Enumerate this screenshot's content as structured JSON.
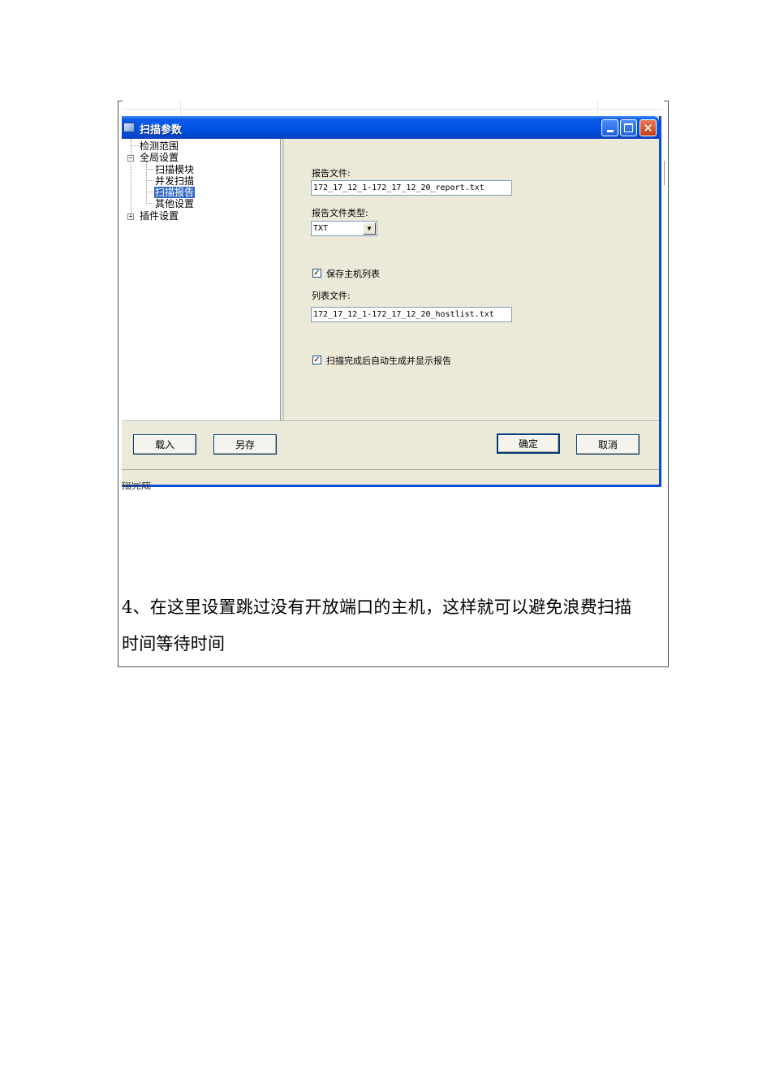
{
  "window": {
    "title": "扫描参数",
    "min_symbol": "",
    "max_symbol": "",
    "close_symbol": "✕"
  },
  "tree": {
    "items": [
      {
        "label": "检测范围"
      },
      {
        "label": "全局设置",
        "expander": "−"
      },
      {
        "label": "扫描模块"
      },
      {
        "label": "并发扫描"
      },
      {
        "label": "扫描报告"
      },
      {
        "label": "其他设置"
      },
      {
        "label": "插件设置",
        "expander": "+"
      }
    ]
  },
  "form": {
    "report_file_label": "报告文件:",
    "report_file_value": "172_17_12_1-172_17_12_20_report.txt",
    "report_type_label": "报告文件类型:",
    "report_type_value": "TXT",
    "save_host_list_label": "保存主机列表",
    "save_host_list_checked": "✓",
    "list_file_label": "列表文件:",
    "list_file_value": "172_17_12_1-172_17_12_20_hostlist.txt",
    "auto_report_label": "扫描完成后自动生成并显示报告",
    "auto_report_checked": "✓"
  },
  "buttons": {
    "load": "载入",
    "save_as": "另存",
    "ok": "确定",
    "cancel": "取消"
  },
  "background": {
    "cut_text": "描完成"
  },
  "document": {
    "paragraph_line1": "4、在这里设置跳过没有开放端口的主机，这样就可以避免浪费扫描",
    "paragraph_line2": "时间等待时间"
  }
}
